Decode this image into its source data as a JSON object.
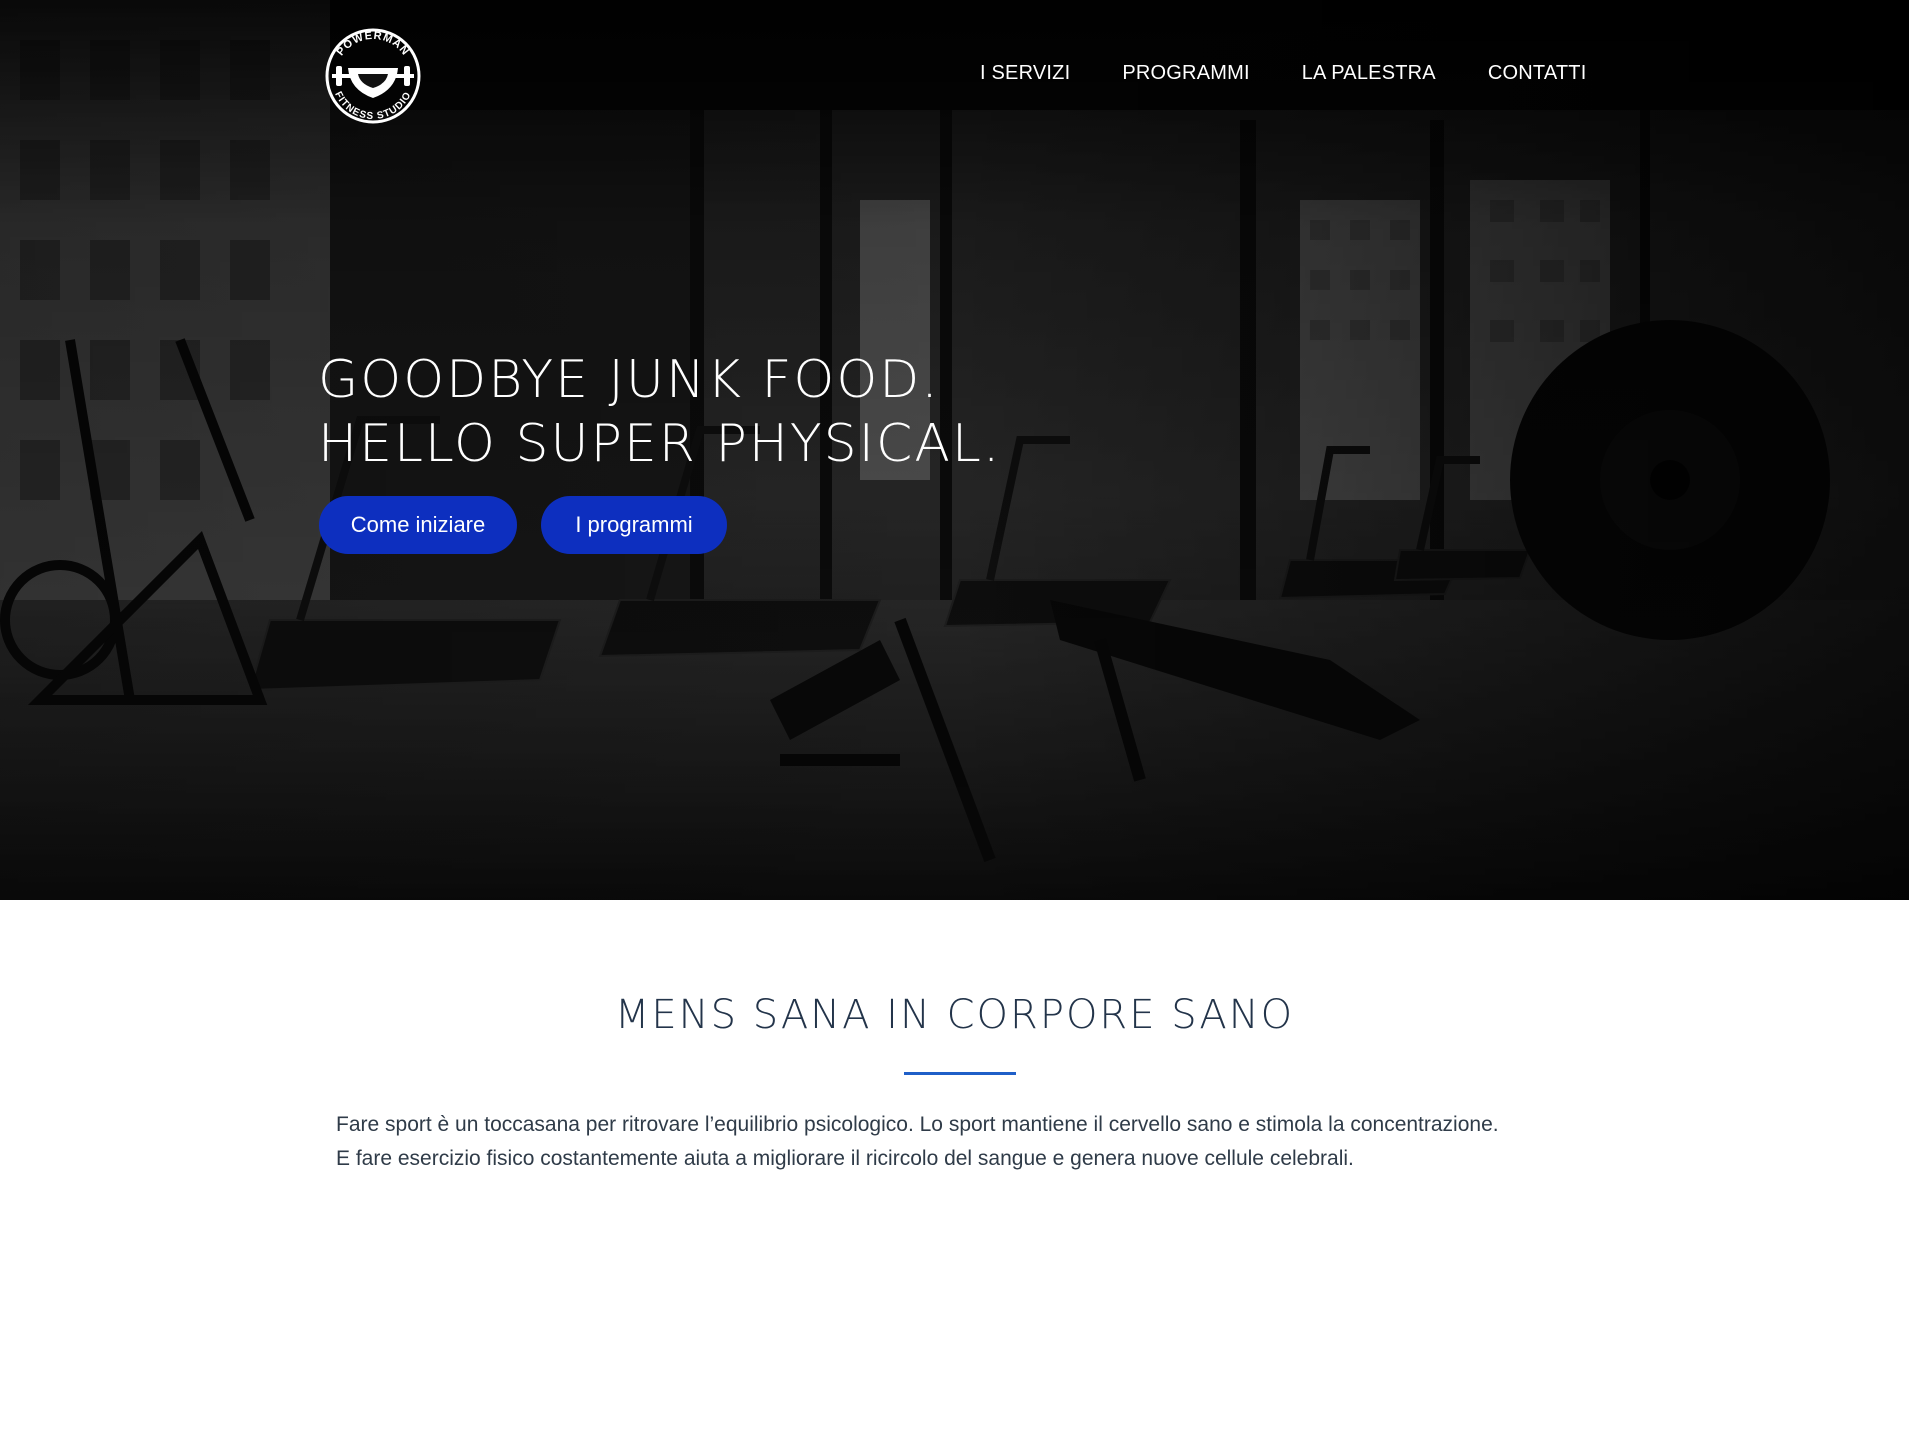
{
  "brand": {
    "logo_top": "POWERMAN",
    "logo_bottom": "FITNESS STUDIO"
  },
  "nav": {
    "items": [
      "I SERVIZI",
      "PROGRAMMI",
      "LA PALESTRA",
      "CONTATTI"
    ]
  },
  "hero": {
    "headline_line1": "GOODBYE JUNK FOOD.",
    "headline_line2": "HELLO SUPER PHYSICAL.",
    "cta_primary": "Come iniziare",
    "cta_secondary": "I programmi",
    "button_color": "#0d2fbf"
  },
  "section": {
    "title": "MENS SANA IN CORPORE SANO",
    "divider_color": "#1f5fc8",
    "paragraph_line1": "Fare sport è un toccasana per ritrovare l’equilibrio psicologico. Lo sport mantiene il cervello sano e stimola la concentrazione.",
    "paragraph_line2": "E fare esercizio fisico costantemente aiuta a migliorare il ricircolo del sangue e genera nuove cellule celebrali."
  }
}
